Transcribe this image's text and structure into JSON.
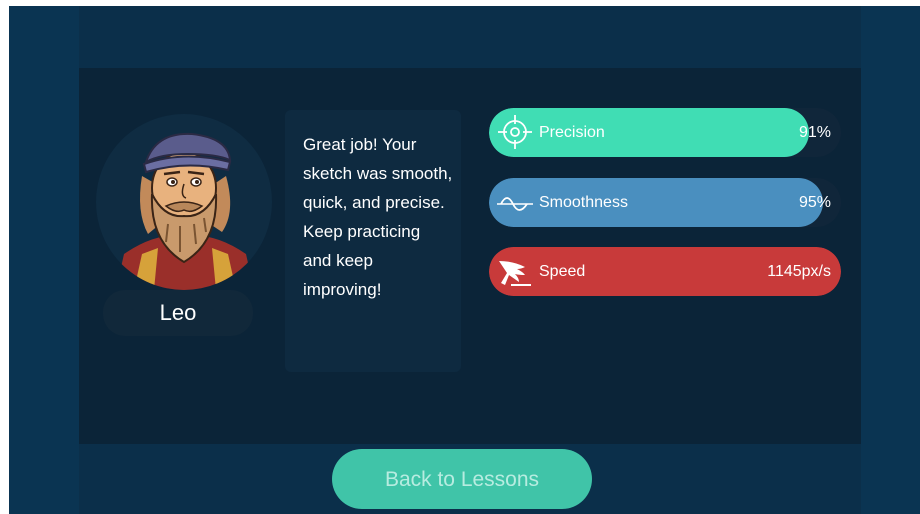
{
  "character": {
    "name": "Leo"
  },
  "feedback": {
    "message": "Great job! Your sketch was smooth, quick, and precise. Keep practicing and keep improving!"
  },
  "stats": [
    {
      "label": "Precision",
      "value": "91%",
      "fill": 0.91,
      "color": "#40ddb4",
      "icon": "crosshair-icon"
    },
    {
      "label": "Smoothness",
      "value": "95%",
      "fill": 0.95,
      "color": "#4a8fbf",
      "icon": "wave-icon"
    },
    {
      "label": "Speed",
      "value": "1145px/s",
      "fill": 1.0,
      "color": "#c83a3a",
      "icon": "wing-icon"
    }
  ],
  "actions": {
    "back_label": "Back to Lessons"
  },
  "colors": {
    "background": "#0a3452",
    "card": "#0b2438",
    "accent": "#40c4a8"
  }
}
